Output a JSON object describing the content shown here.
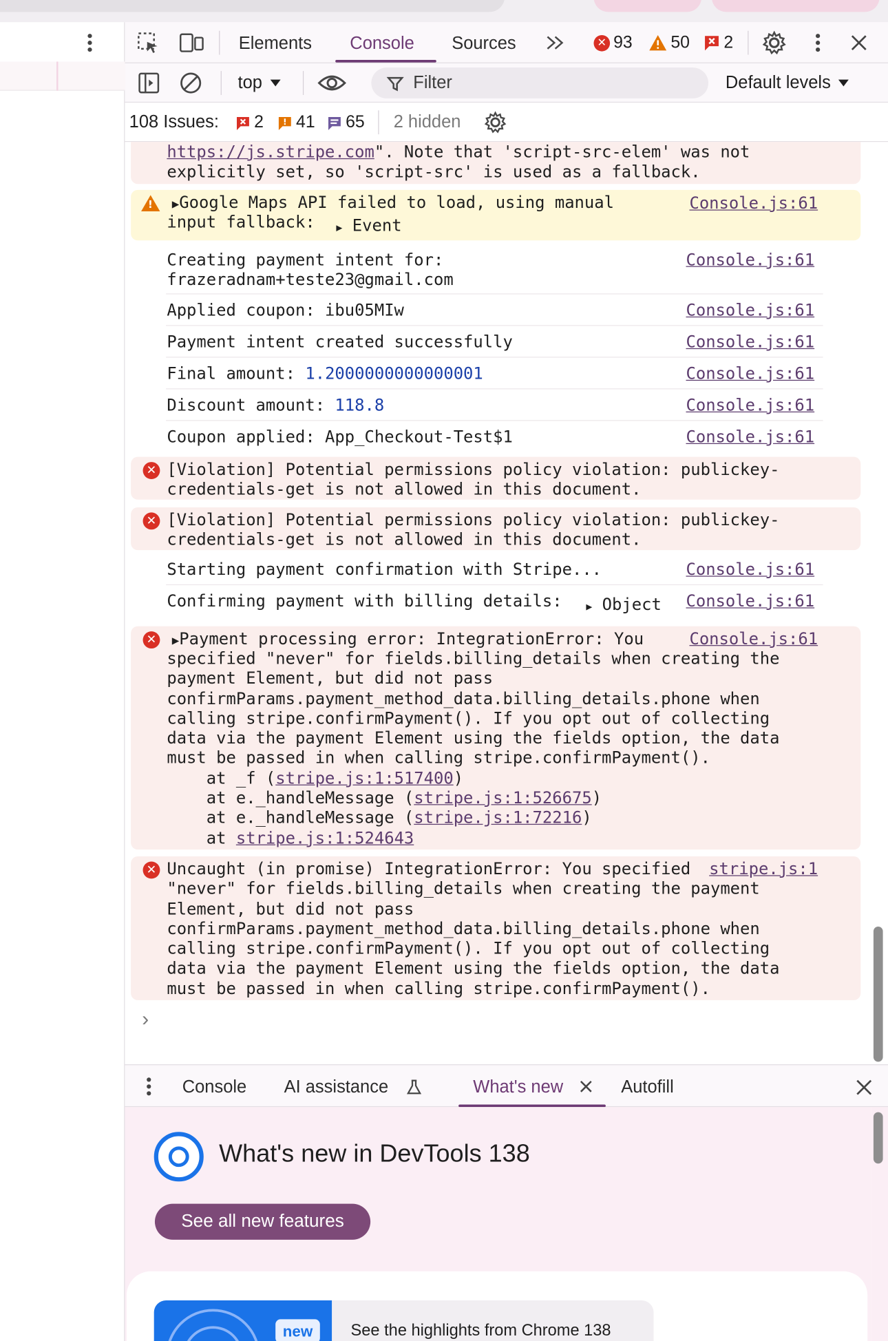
{
  "toolbar": {
    "tabs": [
      "Elements",
      "Console",
      "Sources"
    ],
    "error_count": "93",
    "warning_count": "50",
    "issue_count": "2"
  },
  "console_bar": {
    "context": "top",
    "filter_placeholder": "Filter",
    "levels": "Default levels"
  },
  "issues_bar": {
    "label": "108 Issues:",
    "errors": "2",
    "warnings": "41",
    "info": "65",
    "hidden": "2 hidden"
  },
  "log": {
    "csp_tail": {
      "link": "https://js.stripe.com",
      "line1_rest": "\". Note that 'script-src-elem' was not",
      "line2": "explicitly set, so 'script-src' is used as a fallback."
    },
    "maps_warning": {
      "line1": "Google Maps API failed to load, using manual",
      "line2": "input fallback:",
      "expand": "Event",
      "source": "Console.js:61"
    },
    "creating_intent": {
      "line1": "Creating payment intent for:",
      "line2": "frazeradnam+teste23@gmail.com",
      "source": "Console.js:61"
    },
    "applied_coupon": {
      "text": "Applied coupon: ibu05MIw",
      "source": "Console.js:61"
    },
    "intent_created": {
      "text": "Payment intent created successfully",
      "source": "Console.js:61"
    },
    "final_amount": {
      "label": "Final amount: ",
      "value": "1.2000000000000001",
      "source": "Console.js:61"
    },
    "discount_amount": {
      "label": "Discount amount: ",
      "value": "118.8",
      "source": "Console.js:61"
    },
    "coupon_applied": {
      "text": "Coupon applied: App_Checkout-Test$1",
      "source": "Console.js:61"
    },
    "violation_1": {
      "line1": "[Violation] Potential permissions policy violation: publickey-",
      "line2": "credentials-get is not allowed in this document."
    },
    "violation_2": {
      "line1": "[Violation] Potential permissions policy violation: publickey-",
      "line2": "credentials-get is not allowed in this document."
    },
    "starting_confirmation": {
      "text": "Starting payment confirmation with Stripe...",
      "source": "Console.js:61"
    },
    "confirming_billing": {
      "text": "Confirming payment with billing details:",
      "expand": "Object",
      "source": "Console.js:61"
    },
    "processing_error": {
      "line1": "Payment processing error: IntegrationError: You",
      "line2": "specified \"never\" for fields.billing_details when creating the",
      "line3": "payment Element, but did not pass",
      "line4": "confirmParams.payment_method_data.billing_details.phone when",
      "line5": "calling stripe.confirmPayment(). If you opt out of collecting",
      "line6": "data via the payment Element using the fields option, the data",
      "line7": "must be passed in when calling stripe.confirmPayment().",
      "stack1_pre": "    at _f (",
      "stack1_link": "stripe.js:1:517400",
      "stack2_pre": "    at e._handleMessage (",
      "stack2_link": "stripe.js:1:526675",
      "stack3_pre": "    at e._handleMessage (",
      "stack3_link": "stripe.js:1:72216",
      "stack4_pre": "    at ",
      "stack4_link": "stripe.js:1:524643",
      "close_paren": ")",
      "source": "Console.js:61"
    },
    "uncaught_error": {
      "line1": "Uncaught (in promise) IntegrationError: You specified",
      "line2": "\"never\" for fields.billing_details when creating the payment",
      "line3": "Element, but did not pass",
      "line4": "confirmParams.payment_method_data.billing_details.phone when",
      "line5": "calling stripe.confirmPayment(). If you opt out of collecting",
      "line6": "data via the payment Element using the fields option, the data",
      "line7": "must be passed in when calling stripe.confirmPayment().",
      "source": "stripe.js:1"
    },
    "prompt": "›"
  },
  "drawer": {
    "tabs": [
      "Console",
      "AI assistance",
      "What's new",
      "Autofill"
    ],
    "whats_new_title": "What's new in DevTools 138",
    "see_all_button": "See all new features",
    "badge_new": "new",
    "highlight_text": "See the highlights from Chrome 138"
  },
  "colors": {
    "accent": "#6d3a74",
    "error_bg": "#fbeeec",
    "warning_bg": "#fef8d8",
    "link": "#5c3c6e",
    "number": "#1a3fa8",
    "error_icon": "#d93025",
    "warning_icon": "#e37400"
  }
}
